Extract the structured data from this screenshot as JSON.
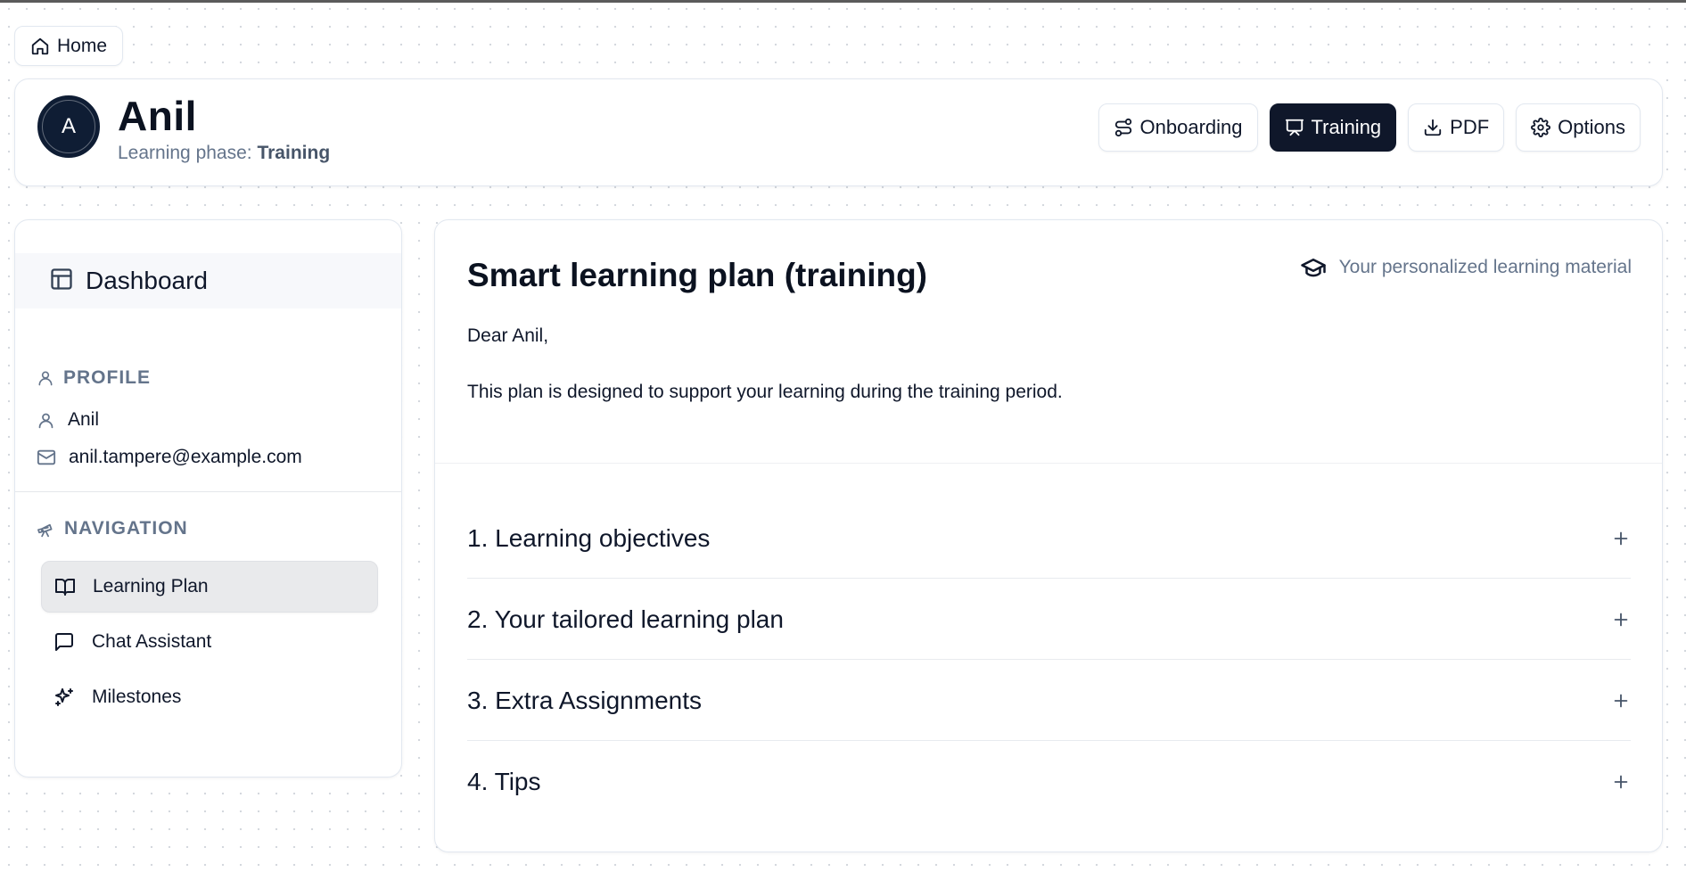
{
  "home": {
    "label": "Home",
    "icon": "home-icon"
  },
  "header": {
    "avatar_letter": "A",
    "name": "Anil",
    "phase_prefix": "Learning phase: ",
    "phase_value": "Training",
    "buttons": [
      {
        "label": "Onboarding",
        "icon": "route-icon",
        "active": false
      },
      {
        "label": "Training",
        "icon": "presentation-icon",
        "active": true
      },
      {
        "label": "PDF",
        "icon": "download-icon",
        "active": false
      },
      {
        "label": "Options",
        "icon": "gear-icon",
        "active": false
      }
    ],
    "active_color": "#0f172a"
  },
  "sidebar": {
    "dashboard_label": "Dashboard",
    "profile_title": "PROFILE",
    "profile_name": "Anil",
    "profile_email": "anil.tampere@example.com",
    "navigation_title": "NAVIGATION",
    "nav_items": [
      {
        "label": "Learning Plan",
        "icon": "book-open-icon",
        "active": true
      },
      {
        "label": "Chat Assistant",
        "icon": "message-square-icon",
        "active": false
      },
      {
        "label": "Milestones",
        "icon": "sparkles-icon",
        "active": false
      }
    ]
  },
  "main": {
    "title": "Smart learning plan (training)",
    "tag": "Your personalized learning material",
    "greeting": "Dear Anil,",
    "intro": "This plan is designed to support your learning during the training period.",
    "sections": [
      {
        "label": "1. Learning objectives"
      },
      {
        "label": "2. Your tailored learning plan"
      },
      {
        "label": "3. Extra Assignments"
      },
      {
        "label": "4. Tips"
      }
    ]
  }
}
